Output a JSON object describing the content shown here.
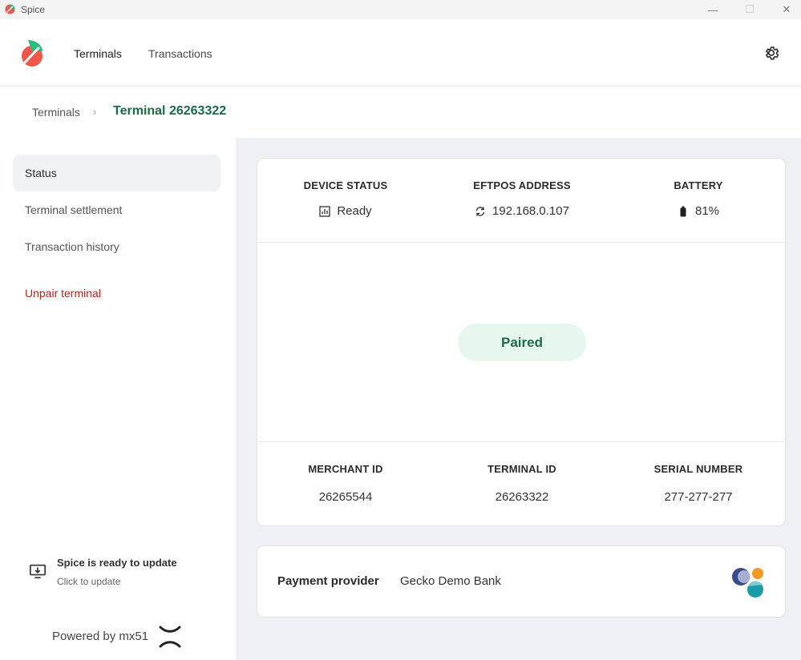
{
  "window": {
    "title": "Spice",
    "minimize": "—",
    "maximize": "☐",
    "close": "✕"
  },
  "nav": {
    "terminals": "Terminals",
    "transactions": "Transactions"
  },
  "breadcrumb": {
    "home": "Terminals",
    "separator": "›",
    "current": "Terminal 26263322"
  },
  "sidebar": {
    "items": [
      {
        "label": "Status",
        "active": true
      },
      {
        "label": "Terminal settlement"
      },
      {
        "label": "Transaction history"
      },
      {
        "label": "Unpair terminal",
        "danger": true
      }
    ],
    "update": {
      "title": "Spice is ready to update",
      "subtitle": "Click to update"
    },
    "powered_by": "Powered by mx51"
  },
  "status": {
    "device_status_label": "DEVICE STATUS",
    "device_status_value": "Ready",
    "eftpos_address_label": "EFTPOS ADDRESS",
    "eftpos_address_value": "192.168.0.107",
    "battery_label": "BATTERY",
    "battery_value": "81%",
    "pairing": "Paired",
    "merchant_id_label": "MERCHANT ID",
    "merchant_id_value": "26265544",
    "terminal_id_label": "TERMINAL ID",
    "terminal_id_value": "26263322",
    "serial_number_label": "SERIAL NUMBER",
    "serial_number_value": "277-277-277"
  },
  "provider": {
    "label": "Payment provider",
    "value": "Gecko Demo Bank"
  },
  "icons": {
    "settings": "gear-icon",
    "device": "bar-chart-icon",
    "address": "sync-icon",
    "battery": "battery-icon",
    "update": "download-monitor-icon"
  },
  "colors": {
    "brand_green": "#1b6b48",
    "brand_red": "#f0574a",
    "danger": "#b3261e",
    "paired_bg": "#e8f7ee",
    "main_bg": "#eef0f3"
  }
}
